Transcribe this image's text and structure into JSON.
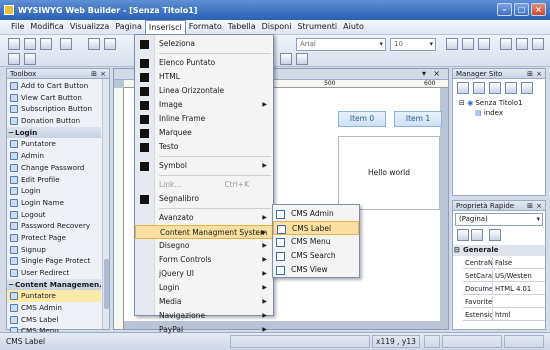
{
  "window": {
    "title": "WYSIWYG Web Builder - [Senza Titolo1]"
  },
  "menubar": [
    "File",
    "Modifica",
    "Visualizza",
    "Pagina",
    "Inserisci",
    "Formato",
    "Tabella",
    "Disponi",
    "Strumenti",
    "Aiuto"
  ],
  "toolbar": {
    "font_name": "Arial",
    "font_size": "10"
  },
  "toolbox": {
    "title": "Toolbox",
    "items": [
      {
        "label": "Add to Cart Button",
        "kind": "item"
      },
      {
        "label": "View Cart Button",
        "kind": "item"
      },
      {
        "label": "Subscription Button",
        "kind": "item"
      },
      {
        "label": "Donation Button",
        "kind": "item"
      },
      {
        "label": "Login",
        "kind": "cat"
      },
      {
        "label": "Puntatore",
        "kind": "item"
      },
      {
        "label": "Admin",
        "kind": "item"
      },
      {
        "label": "Change Password",
        "kind": "item"
      },
      {
        "label": "Edit Profile",
        "kind": "item"
      },
      {
        "label": "Login",
        "kind": "item"
      },
      {
        "label": "Login Name",
        "kind": "item"
      },
      {
        "label": "Logout",
        "kind": "item"
      },
      {
        "label": "Password Recovery",
        "kind": "item"
      },
      {
        "label": "Protect Page",
        "kind": "item"
      },
      {
        "label": "Signup",
        "kind": "item"
      },
      {
        "label": "Single Page Protect",
        "kind": "item"
      },
      {
        "label": "User Redirect",
        "kind": "item"
      },
      {
        "label": "Content Managemen...",
        "kind": "cat"
      },
      {
        "label": "Puntatore",
        "kind": "sel"
      },
      {
        "label": "CMS Admin",
        "kind": "item"
      },
      {
        "label": "CMS Label",
        "kind": "item"
      },
      {
        "label": "CMS Menu",
        "kind": "item"
      }
    ]
  },
  "editor": {
    "buttons": [
      "Item 0",
      "Item 1"
    ],
    "hello": "Hello world",
    "ruler_marks": [
      "500",
      "600"
    ]
  },
  "site_manager": {
    "title": "Manager Sito",
    "root": "Senza Titolo1",
    "page": "index"
  },
  "properties": {
    "title": "Proprietà Rapide",
    "selected": "(Pagina)",
    "section": "Generale",
    "rows": [
      {
        "k": "CentraN",
        "v": "False"
      },
      {
        "k": "SetCara",
        "v": "US/Westen"
      },
      {
        "k": "Docume",
        "v": "HTML 4.01"
      },
      {
        "k": "Favorite",
        "v": ""
      },
      {
        "k": "Estensic",
        "v": "html"
      }
    ]
  },
  "status": {
    "left": "CMS Label",
    "coord": "x119 , y13"
  },
  "insert_menu": [
    {
      "label": "Seleziona",
      "icon": "pointer-icon"
    },
    {
      "sep": true
    },
    {
      "label": "Elenco Puntato",
      "icon": "bullet-list-icon"
    },
    {
      "label": "HTML",
      "icon": "html-icon"
    },
    {
      "label": "Linea Orizzontale",
      "icon": "line-icon"
    },
    {
      "label": "Image",
      "icon": "image-icon",
      "sub": true
    },
    {
      "label": "Inline Frame",
      "icon": "iframe-icon"
    },
    {
      "label": "Marquee",
      "icon": "marquee-icon"
    },
    {
      "label": "Testo",
      "icon": "text-icon"
    },
    {
      "sep": true
    },
    {
      "label": "Symbol",
      "icon": "symbol-icon",
      "sub": true
    },
    {
      "sep": true
    },
    {
      "label": "Link...",
      "disabled": true,
      "shortcut": "Ctrl+K"
    },
    {
      "label": "Segnalibro",
      "icon": "bookmark-icon"
    },
    {
      "sep": true
    },
    {
      "label": "Avanzato",
      "sub": true
    },
    {
      "label": "Content Managment System",
      "sub": true,
      "hl": true
    },
    {
      "label": "Disegno",
      "sub": true
    },
    {
      "label": "Form Controls",
      "sub": true
    },
    {
      "label": "jQuery UI",
      "sub": true
    },
    {
      "label": "Login",
      "sub": true
    },
    {
      "label": "Media",
      "sub": true
    },
    {
      "label": "Navigazione",
      "sub": true
    },
    {
      "label": "PayPal",
      "sub": true
    }
  ],
  "cms_submenu": [
    {
      "label": "CMS Admin"
    },
    {
      "label": "CMS Label",
      "hl": true
    },
    {
      "label": "CMS Menu"
    },
    {
      "label": "CMS Search"
    },
    {
      "label": "CMS View"
    }
  ],
  "colors": {
    "titlebar": "#2a5fb5",
    "highlight": "#f9dfa0",
    "button_text": "#2a5b93"
  }
}
